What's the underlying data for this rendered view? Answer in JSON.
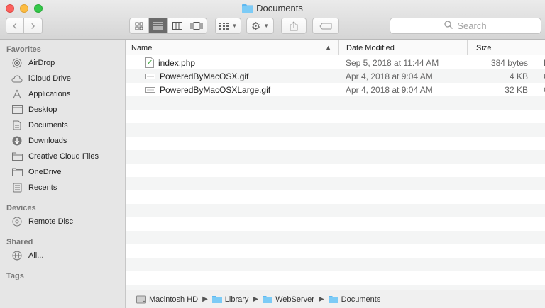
{
  "window": {
    "title": "Documents"
  },
  "toolbar": {
    "back_glyph": "‹",
    "forward_glyph": "›",
    "view_icons": "icon-view-icon",
    "view_list": "list-view-icon",
    "view_columns": "column-view-icon",
    "view_cover": "coverflow-view-icon",
    "search_placeholder": "Search"
  },
  "sidebar": {
    "favorites_label": "Favorites",
    "favorites": [
      {
        "label": "AirDrop",
        "icon": "airdrop-icon"
      },
      {
        "label": "iCloud Drive",
        "icon": "cloud-icon"
      },
      {
        "label": "Applications",
        "icon": "applications-icon"
      },
      {
        "label": "Desktop",
        "icon": "desktop-icon"
      },
      {
        "label": "Documents",
        "icon": "documents-icon"
      },
      {
        "label": "Downloads",
        "icon": "downloads-icon"
      },
      {
        "label": "Creative Cloud Files",
        "icon": "folder-icon"
      },
      {
        "label": "OneDrive",
        "icon": "folder-icon"
      },
      {
        "label": "Recents",
        "icon": "recents-icon"
      }
    ],
    "devices_label": "Devices",
    "devices": [
      {
        "label": "Remote Disc",
        "icon": "disc-icon"
      }
    ],
    "shared_label": "Shared",
    "shared": [
      {
        "label": "All...",
        "icon": "network-icon"
      }
    ],
    "tags_label": "Tags"
  },
  "list": {
    "columns": {
      "name": "Name",
      "date": "Date Modified",
      "size": "Size"
    },
    "rows": [
      {
        "name": "index.php",
        "date": "Sep 5, 2018 at 11:44 AM",
        "size": "384 bytes",
        "kind": "P"
      },
      {
        "name": "PoweredByMacOSX.gif",
        "date": "Apr 4, 2018 at 9:04 AM",
        "size": "4 KB",
        "kind": "G"
      },
      {
        "name": "PoweredByMacOSXLarge.gif",
        "date": "Apr 4, 2018 at 9:04 AM",
        "size": "32 KB",
        "kind": "G"
      }
    ]
  },
  "pathbar": {
    "items": [
      "Macintosh HD",
      "Library",
      "WebServer",
      "Documents"
    ]
  }
}
